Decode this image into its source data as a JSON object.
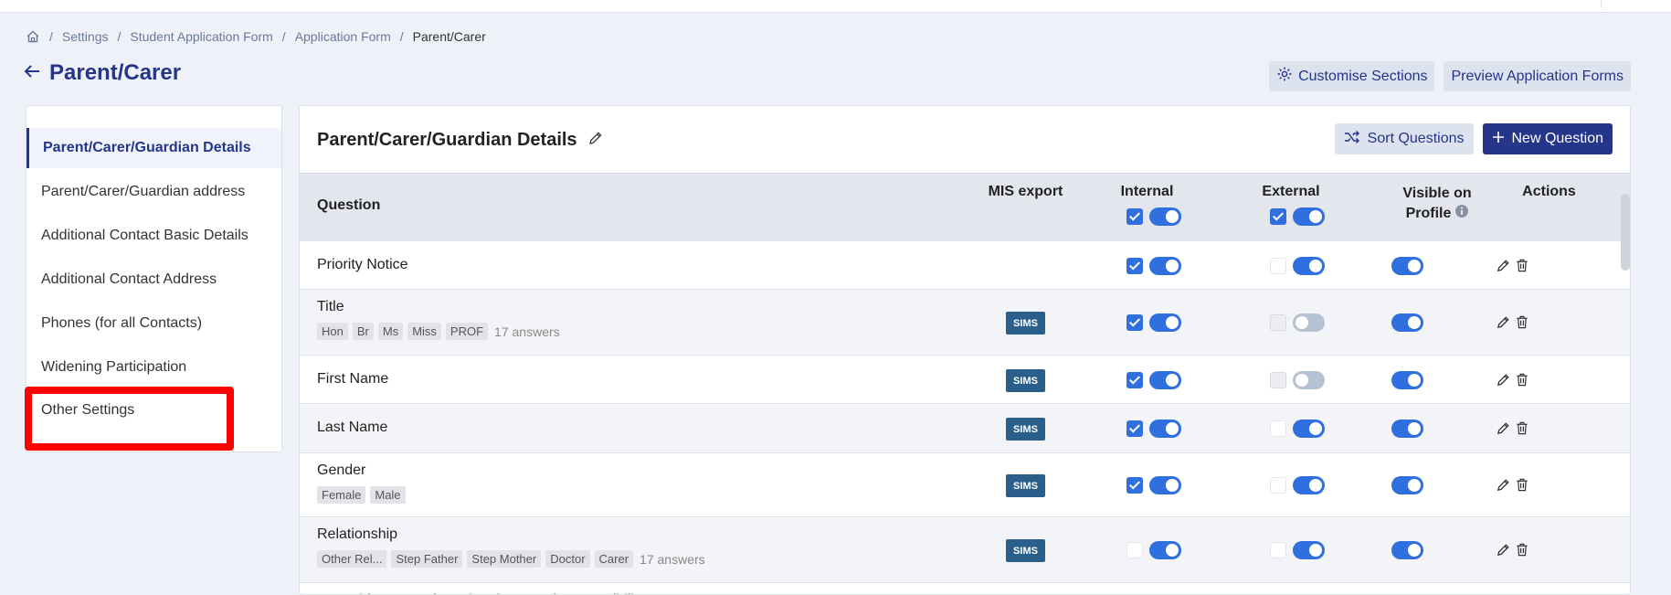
{
  "breadcrumb": [
    "Settings",
    "Student Application Form",
    "Application Form",
    "Parent/Carer"
  ],
  "page_title": "Parent/Carer",
  "top_actions": {
    "customise": "Customise Sections",
    "preview": "Preview Application Forms"
  },
  "sidebar": {
    "items": [
      {
        "label": "Parent/Carer/Guardian Details",
        "active": true
      },
      {
        "label": "Parent/Carer/Guardian address"
      },
      {
        "label": "Additional Contact Basic Details"
      },
      {
        "label": "Additional Contact Address"
      },
      {
        "label": "Phones (for all Contacts)"
      },
      {
        "label": "Widening Participation"
      },
      {
        "label": "Other Settings"
      }
    ]
  },
  "main": {
    "title": "Parent/Carer/Guardian Details",
    "sort_label": "Sort Questions",
    "new_label": "New Question",
    "columns": {
      "question": "Question",
      "mis": "MIS export",
      "internal": "Internal",
      "external": "External",
      "visible": "Visible on",
      "visible2": "Profile",
      "actions": "Actions"
    },
    "sims_label": "SIMS",
    "rows": [
      {
        "question": "Priority Notice",
        "tags": [],
        "answers": "",
        "sims": false,
        "internal_cb": "on",
        "internal_tg": "on",
        "external_cb": "off",
        "external_tg": "on",
        "visible_tg": "on"
      },
      {
        "question": "Title",
        "tags": [
          "Hon",
          "Br",
          "Ms",
          "Miss",
          "PROF"
        ],
        "answers": "17 answers",
        "sims": true,
        "internal_cb": "on",
        "internal_tg": "on",
        "external_cb": "dis",
        "external_tg": "off",
        "visible_tg": "on"
      },
      {
        "question": "First Name",
        "tags": [],
        "answers": "",
        "sims": true,
        "internal_cb": "on",
        "internal_tg": "on",
        "external_cb": "dis",
        "external_tg": "off",
        "visible_tg": "on"
      },
      {
        "question": "Last Name",
        "tags": [],
        "answers": "",
        "sims": true,
        "internal_cb": "on",
        "internal_tg": "on",
        "external_cb": "off",
        "external_tg": "on",
        "visible_tg": "on"
      },
      {
        "question": "Gender",
        "tags": [
          "Female",
          "Male"
        ],
        "answers": "",
        "sims": true,
        "internal_cb": "on",
        "internal_tg": "on",
        "external_cb": "off",
        "external_tg": "on",
        "visible_tg": "on"
      },
      {
        "question": "Relationship",
        "tags": [
          "Other Rel...",
          "Step Father",
          "Step Mother",
          "Doctor",
          "Carer"
        ],
        "answers": "17 answers",
        "sims": true,
        "internal_cb": "off",
        "internal_tg": "on",
        "external_cb": "off",
        "external_tg": "on",
        "visible_tg": "on"
      },
      {
        "question": "Does this contact have legal parental responsibility?",
        "tags": [],
        "answers": "",
        "sims": false,
        "partial": true
      }
    ]
  },
  "colors": {
    "brand": "#24358a",
    "accent": "#2f6fde",
    "sims": "#2a5f8c",
    "highlight": "#ff0000"
  }
}
